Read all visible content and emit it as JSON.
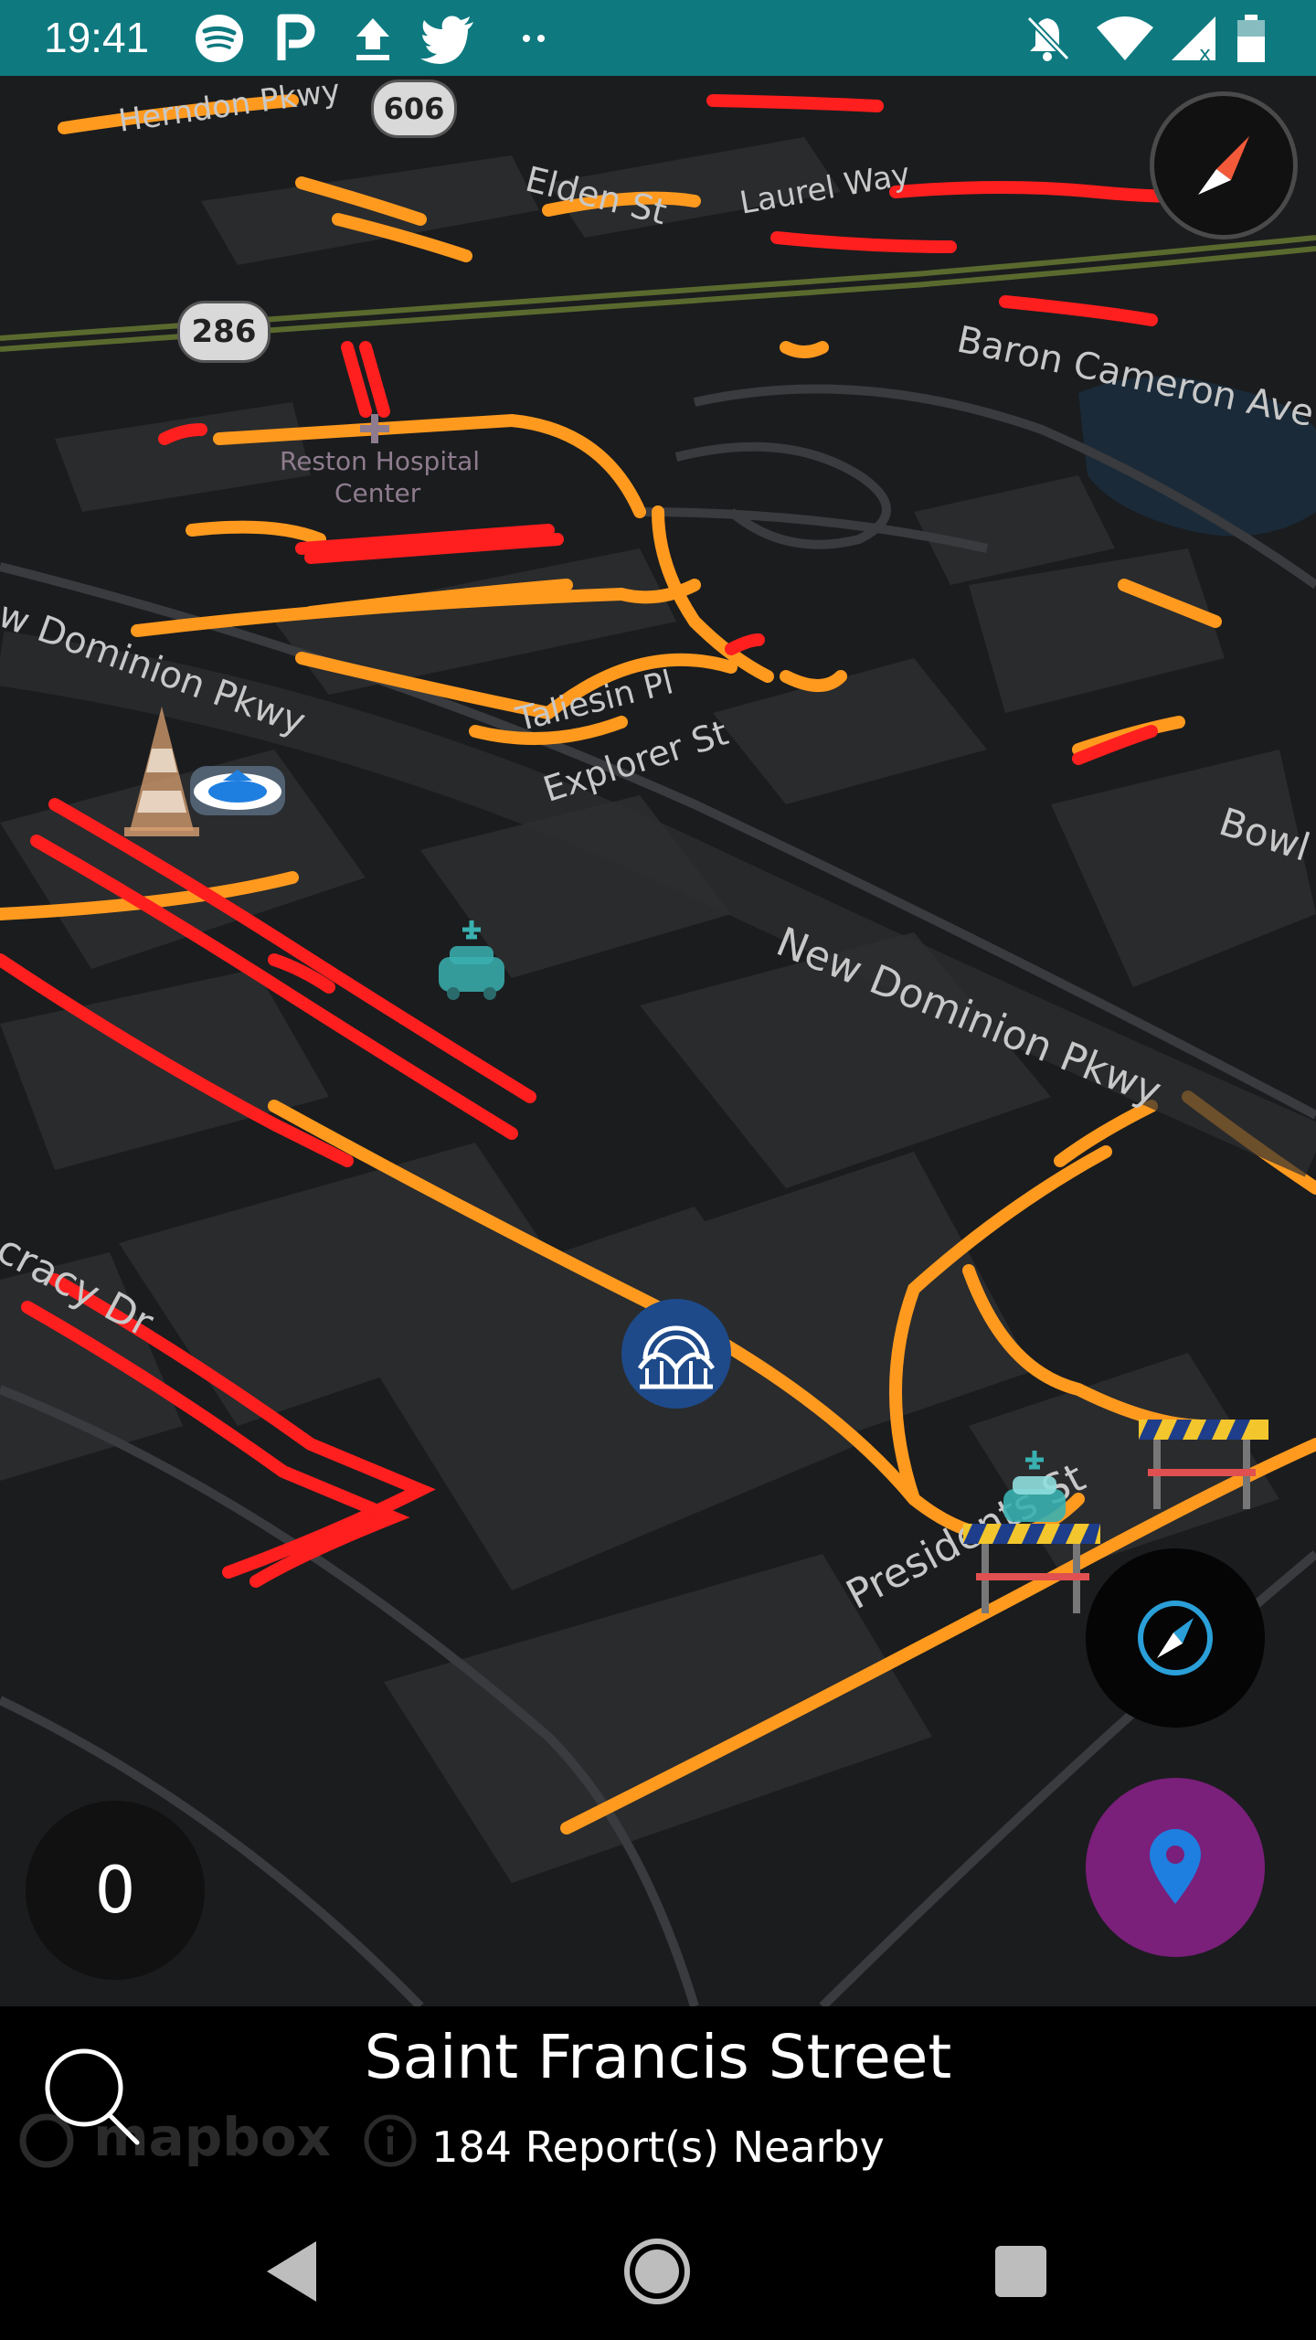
{
  "status_bar": {
    "time": "19:41",
    "left_icons": [
      "spotify-icon",
      "parking-icon",
      "upload-icon",
      "twitter-icon",
      "more-dots-icon"
    ],
    "right_icons": [
      "notifications-off-icon",
      "wifi-icon",
      "signal-icon",
      "battery-icon"
    ]
  },
  "map": {
    "street_labels": [
      {
        "text": "Herndon Pkwy"
      },
      {
        "text": "Elden St"
      },
      {
        "text": "Laurel Way"
      },
      {
        "text": "Baron Cameron Ave"
      },
      {
        "text": "Reston Hospital"
      },
      {
        "text": "Center"
      },
      {
        "text": "w Dominion Pkwy"
      },
      {
        "text": "Taliesin Pl"
      },
      {
        "text": "Explorer St"
      },
      {
        "text": "Bowl"
      },
      {
        "text": "New Dominion Pkwy"
      },
      {
        "text": "cracy Dr"
      },
      {
        "text": "Presidents St"
      }
    ],
    "route_shields": [
      "606",
      "286"
    ],
    "markers": [
      "traffic-cone-icon",
      "police-car-icon",
      "ev-charging-icon",
      "amusement-park-icon",
      "ev-charging-icon",
      "road-closure-icon",
      "road-closure-icon"
    ],
    "attribution": "mapbox"
  },
  "controls": {
    "report_counter": "0",
    "compass_icon": "compass-icon",
    "recenter_icon": "recenter-compass-icon",
    "locate_icon": "location-pin-icon",
    "accent_locate": "#7a1f7a",
    "accent_pin": "#1e7fe0"
  },
  "bottom_panel": {
    "title": "Saint Francis Street",
    "subtitle": "184 Report(s) Nearby",
    "search_icon": "search-icon"
  },
  "nav_bar": {
    "buttons": [
      "back-icon",
      "home-icon",
      "recents-icon"
    ]
  },
  "colors": {
    "status_bar": "#0e7a80",
    "traffic_heavy": "#ff1f1f",
    "traffic_moderate": "#ff9a1f"
  }
}
